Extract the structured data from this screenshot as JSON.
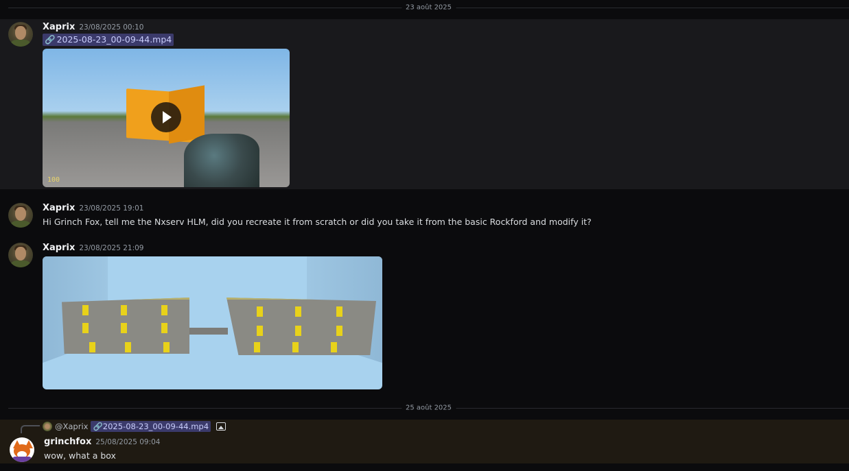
{
  "dividers": [
    {
      "label": "23 août 2025"
    },
    {
      "label": "25 août 2025"
    }
  ],
  "messages": [
    {
      "author": "Xaprix",
      "timestamp": "23/08/2025 00:10",
      "attachment": "2025-08-23_00-09-44.mp4",
      "video_hud": "100"
    },
    {
      "author": "Xaprix",
      "timestamp": "23/08/2025 19:01",
      "text": "Hi Grinch Fox, tell me the Nxserv HLM, did you recreate it from scratch or did you take it from the basic Rockford and modify it?"
    },
    {
      "author": "Xaprix",
      "timestamp": "23/08/2025 21:09"
    },
    {
      "author": "grinchfox",
      "timestamp": "25/08/2025 09:04",
      "text": "wow, what a box",
      "reply": {
        "mention": "@Xaprix",
        "attachment": "2025-08-23_00-09-44.mp4"
      }
    }
  ],
  "icons": {
    "attachment": "paperclip-icon",
    "play": "play-icon",
    "image": "image-icon"
  }
}
